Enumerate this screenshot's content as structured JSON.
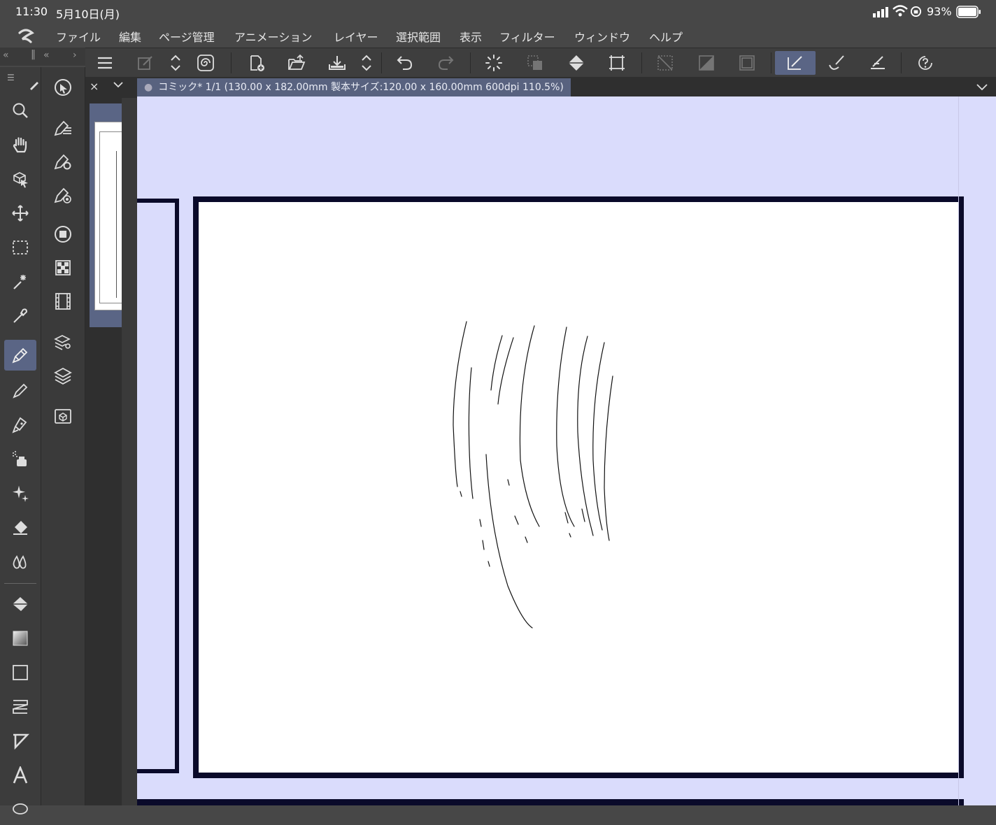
{
  "status": {
    "time": "11:30",
    "date": "5月10日(月)",
    "battery": "93%"
  },
  "menu": [
    "ファイル",
    "編集",
    "ページ管理",
    "アニメーション",
    "レイヤー",
    "選択範囲",
    "表示",
    "フィルター",
    "ウィンドウ",
    "ヘルプ"
  ],
  "document": {
    "tab_label": "コミック* 1/1 (130.00 x 182.00mm 製本サイズ:120.00 x 160.00mm 600dpi 110.5%)"
  },
  "colors": {
    "accent": "#5a6585",
    "canvas_bg": "#dadcfc",
    "panel_border": "#0a0a2a"
  },
  "icons": {
    "toolbar": [
      "hamburger-menu-icon",
      "edit-layer-icon",
      "vertical-arrows-icon",
      "spiral-icon",
      "new-page-icon",
      "open-folder-icon",
      "save-icon",
      "vertical-arrows-icon",
      "undo-icon",
      "redo-icon",
      "loading-spinner-icon",
      "transform-selection-icon",
      "fill-bucket-icon",
      "crop-icon",
      "deselect-icon",
      "invert-selection-icon",
      "frame-icon",
      "pen-check-icon",
      "brush-icon",
      "ruler-pen-icon",
      "help-icon"
    ],
    "tools": [
      "zoom-icon",
      "hand-icon",
      "object-select-icon",
      "move-icon",
      "marquee-icon",
      "magic-wand-icon",
      "eyedropper-icon",
      "pen-icon",
      "pencil-icon",
      "marker-icon",
      "airbrush-icon",
      "decoration-icon",
      "eraser-icon",
      "blend-icon",
      "fill-icon",
      "gradient-icon",
      "shape-rectangle-icon",
      "frame-border-icon",
      "ruler-icon",
      "text-icon"
    ]
  }
}
